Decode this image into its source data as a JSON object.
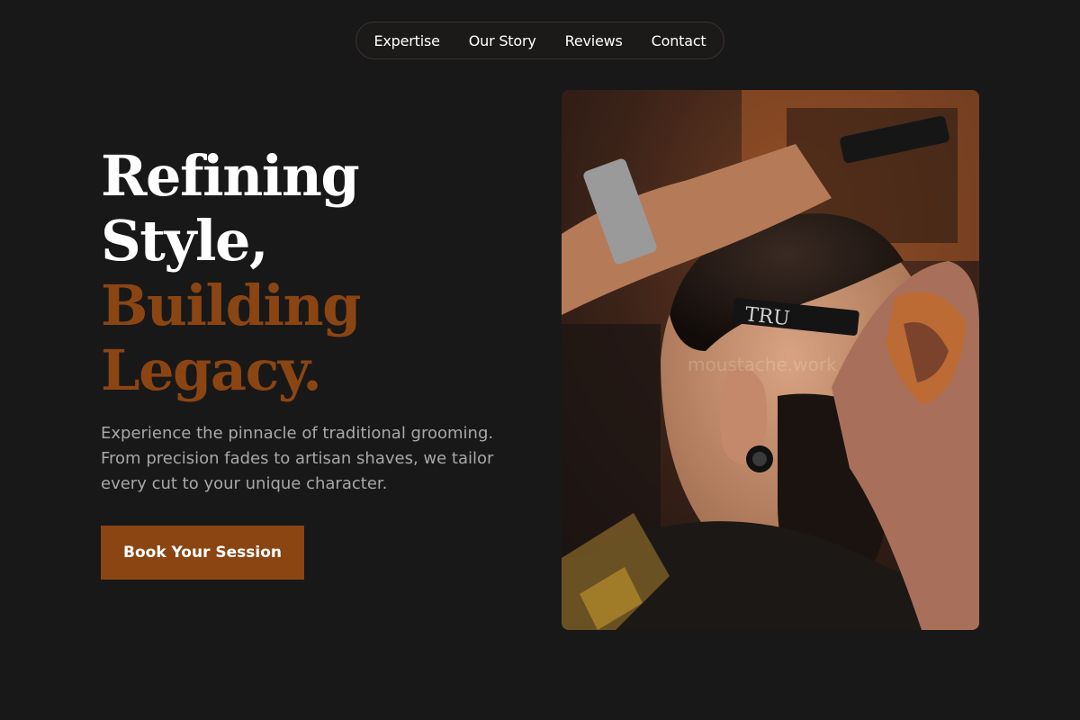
{
  "nav": {
    "items": [
      {
        "label": "Expertise"
      },
      {
        "label": "Our Story"
      },
      {
        "label": "Reviews"
      },
      {
        "label": "Contact"
      }
    ]
  },
  "hero": {
    "title_line1": "Refining",
    "title_line2": "Style,",
    "title_line3": "Building",
    "title_line4": "Legacy.",
    "subtitle": "Experience the pinnacle of traditional grooming. From precision fades to artisan shaves, we tailor every cut to your unique character.",
    "cta_label": "Book Your Session"
  },
  "image": {
    "razor_text": "TRU",
    "watermark": "moustache.work"
  },
  "colors": {
    "background": "#191818",
    "accent": "#8b4513",
    "text_muted": "#a8a8aa"
  }
}
